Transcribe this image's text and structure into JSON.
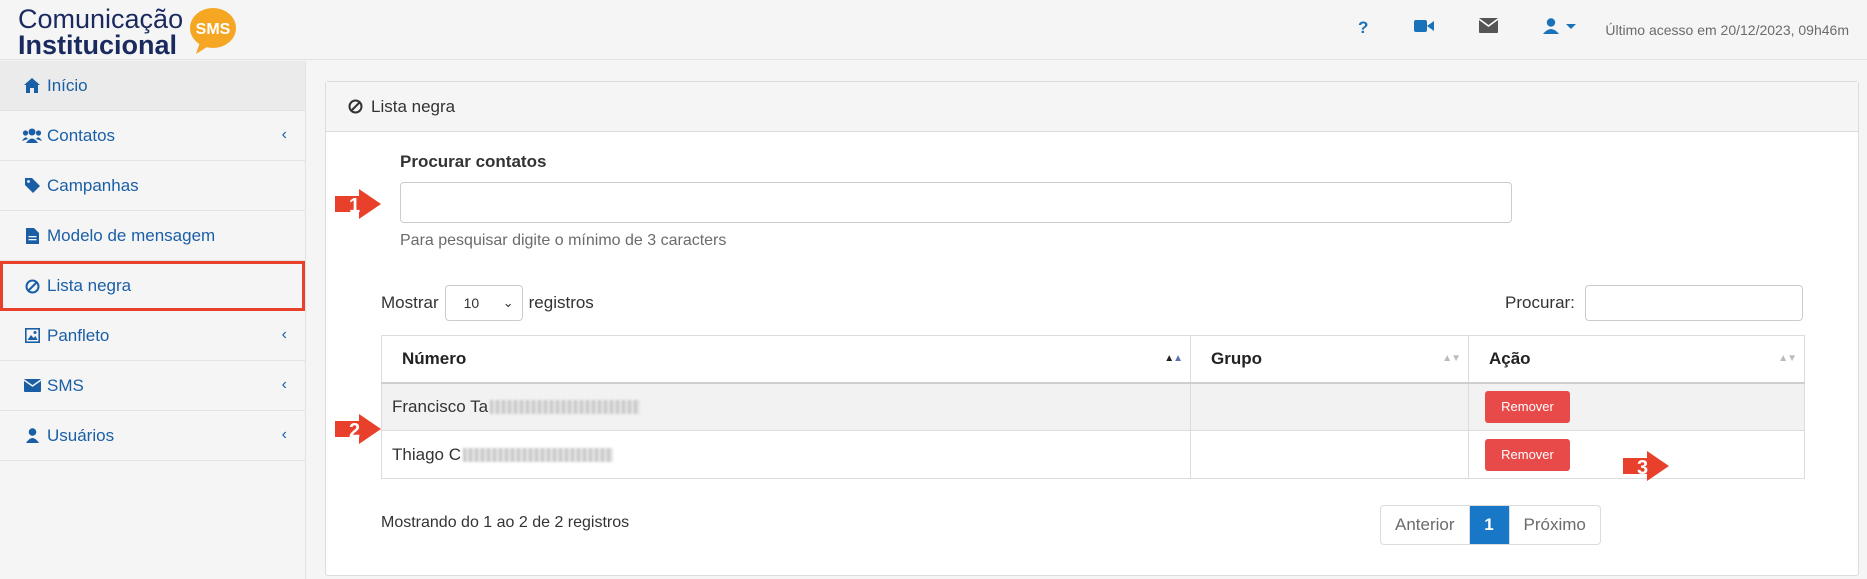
{
  "brand": {
    "line1": "Comunicação",
    "line2": "Institucional",
    "badge": "SMS"
  },
  "topbar": {
    "icons": [
      "help-icon",
      "video-icon",
      "envelope-icon",
      "user-icon",
      "caret-down-icon"
    ],
    "help_glyph": "?",
    "last_access": "Último acesso em 20/12/2023, 09h46m"
  },
  "sidebar": {
    "items": [
      {
        "label": "Início",
        "icon": "home-icon"
      },
      {
        "label": "Contatos",
        "icon": "users-icon",
        "has_submenu": true
      },
      {
        "label": "Campanhas",
        "icon": "tag-icon"
      },
      {
        "label": "Modelo de mensagem",
        "icon": "file-icon"
      },
      {
        "label": "Lista negra",
        "icon": "ban-icon",
        "active": true
      },
      {
        "label": "Panfleto",
        "icon": "image-icon",
        "has_submenu": true
      },
      {
        "label": "SMS",
        "icon": "envelope-icon",
        "has_submenu": true
      },
      {
        "label": "Usuários",
        "icon": "user-icon",
        "has_submenu": true
      }
    ]
  },
  "panel": {
    "title": "Lista negra",
    "search_label": "Procurar contatos",
    "search_value": "",
    "search_help": "Para pesquisar digite o mínimo de 3 caracters",
    "length_prefix": "Mostrar",
    "length_value": "10",
    "length_suffix": "registros",
    "filter_label": "Procurar:",
    "filter_value": ""
  },
  "table": {
    "columns": [
      "Número",
      "Grupo",
      "Ação"
    ],
    "rows": [
      {
        "numero": "Francisco Ta",
        "grupo": "",
        "acao": "Remover"
      },
      {
        "numero": "Thiago C",
        "grupo": "",
        "acao": "Remover"
      }
    ]
  },
  "footer": {
    "info": "Mostrando do 1 ao 2 de 2 registros",
    "pagination": [
      "Anterior",
      "1",
      "Próximo"
    ]
  },
  "markers": [
    "1",
    "2",
    "3"
  ],
  "colors": {
    "accent": "#1877c7",
    "link": "#1a5fa6",
    "danger": "#e84a4a",
    "marker": "#e8402a",
    "brand_orange": "#f5a623"
  }
}
